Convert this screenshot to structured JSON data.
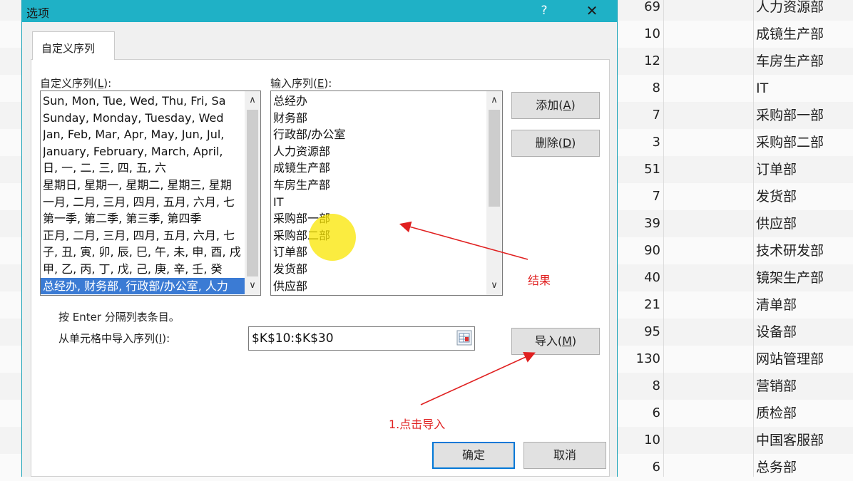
{
  "sheet": {
    "rows": [
      {
        "num": "69",
        "dept": "人力资源部"
      },
      {
        "num": "10",
        "dept": "成镜生产部"
      },
      {
        "num": "12",
        "dept": "车房生产部"
      },
      {
        "num": "8",
        "dept": "IT"
      },
      {
        "num": "7",
        "dept": "采购部一部"
      },
      {
        "num": "3",
        "dept": "采购部二部"
      },
      {
        "num": "51",
        "dept": "订单部"
      },
      {
        "num": "7",
        "dept": "发货部"
      },
      {
        "num": "39",
        "dept": "供应部"
      },
      {
        "num": "90",
        "dept": "技术研发部"
      },
      {
        "num": "40",
        "dept": "镜架生产部"
      },
      {
        "num": "21",
        "dept": "清单部"
      },
      {
        "num": "95",
        "dept": "设备部"
      },
      {
        "num": "130",
        "dept": "网站管理部"
      },
      {
        "num": "8",
        "dept": "营销部"
      },
      {
        "num": "6",
        "dept": "质检部"
      },
      {
        "num": "10",
        "dept": "中国客服部"
      },
      {
        "num": "6",
        "dept": "总务部"
      }
    ]
  },
  "dialog": {
    "title": "选项",
    "help_label": "?",
    "close_label": "✕",
    "tab_label": "自定义序列",
    "custom_lists_label": "自定义序列(",
    "custom_lists_key": "L",
    "custom_lists_tail": "):",
    "entries_label": "输入序列(",
    "entries_key": "E",
    "entries_tail": "):",
    "custom_lists": [
      "Sun, Mon, Tue, Wed, Thu, Fri, Sa",
      "Sunday, Monday, Tuesday, Wed",
      "Jan, Feb, Mar, Apr, May, Jun, Jul,",
      "January, February, March, April,",
      "日, 一, 二, 三, 四, 五, 六",
      "星期日, 星期一, 星期二, 星期三, 星期",
      "一月, 二月, 三月, 四月, 五月, 六月, 七",
      "第一季, 第二季, 第三季, 第四季",
      "正月, 二月, 三月, 四月, 五月, 六月, 七",
      "子, 丑, 寅, 卯, 辰, 巳, 午, 未, 申, 酉, 戌",
      "甲, 乙, 丙, 丁, 戊, 己, 庚, 辛, 壬, 癸",
      "总经办, 财务部, 行政部/办公室, 人力"
    ],
    "entries": [
      "总经办",
      "财务部",
      "行政部/办公室",
      "人力资源部",
      "成镜生产部",
      "车房生产部",
      "IT",
      "采购部一部",
      "采购部二部",
      "订单部",
      "发货部",
      "供应部"
    ],
    "add_button": "添加(",
    "add_key": "A",
    "add_tail": ")",
    "delete_button": "删除(",
    "delete_key": "D",
    "delete_tail": ")",
    "hint": "按 Enter 分隔列表条目。",
    "import_label": "从单元格中导入序列(",
    "import_key": "I",
    "import_tail": "):",
    "import_range": "$K$10:$K$30",
    "import_button": "导入(",
    "import_key_btn": "M",
    "import_tail_btn": ")",
    "ok_button": "确定",
    "cancel_button": "取消"
  },
  "annotations": {
    "result": "结果",
    "step1": "1.点击导入",
    "color": "#e02020"
  }
}
